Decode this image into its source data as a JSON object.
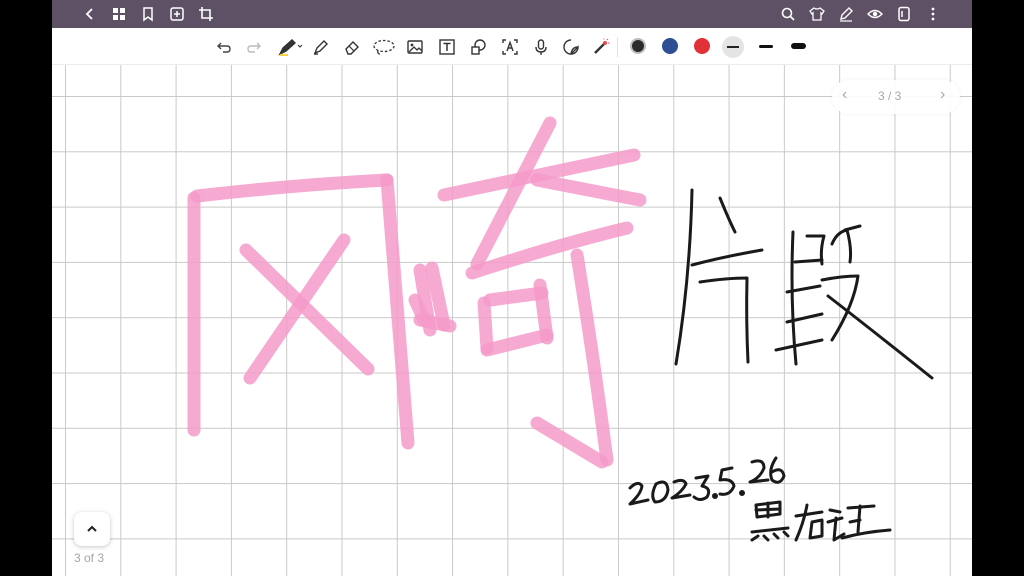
{
  "toolbar": {
    "colors": [
      "#2b2b2b",
      "#2e4f93",
      "#e23237"
    ],
    "top_icons_left": [
      "back-icon",
      "grid-icon",
      "bookmark-icon",
      "add-page-icon",
      "crop-icon"
    ],
    "top_icons_right": [
      "search-icon",
      "shirt-icon",
      "pen-icon",
      "eye-icon",
      "notebook-icon",
      "more-icon"
    ]
  },
  "pager": {
    "label": "3 / 3"
  },
  "footer": {
    "page_count": "3 of 3"
  },
  "ink_colors": {
    "highlighter": "#f59ac9",
    "pen": "#1a1a1a"
  }
}
